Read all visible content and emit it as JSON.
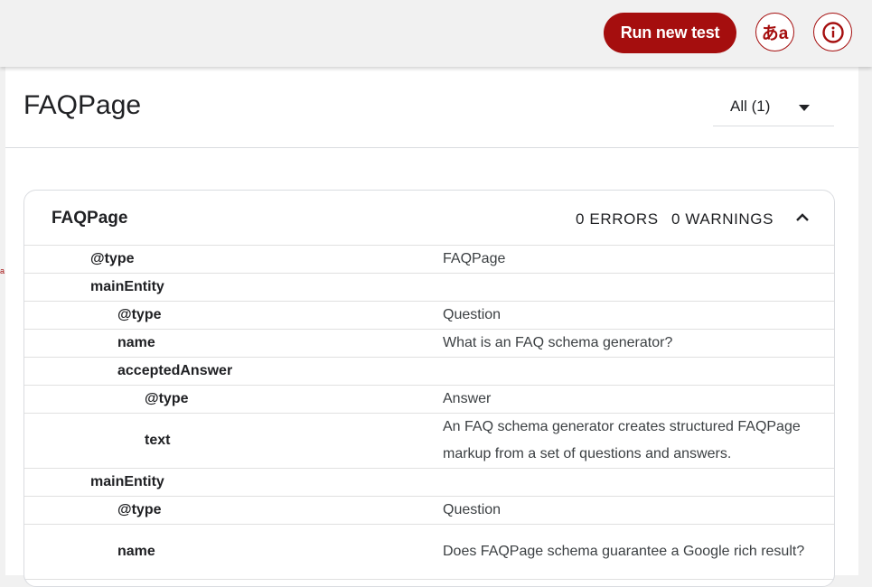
{
  "header": {
    "run_button": "Run new test",
    "language_button": "あa",
    "info_button_icon": "info-icon"
  },
  "panel": {
    "title": "FAQPage",
    "filter_label": "All (1)"
  },
  "card": {
    "title": "FAQPage",
    "errors": "0 ERRORS",
    "warnings": "0 WARNINGS",
    "rows": [
      {
        "key": "@type",
        "value": "FAQPage"
      },
      {
        "key": "mainEntity",
        "value": ""
      },
      {
        "key": "@type",
        "value": "Question"
      },
      {
        "key": "name",
        "value": "What is an FAQ schema generator?"
      },
      {
        "key": "acceptedAnswer",
        "value": ""
      },
      {
        "key": "@type",
        "value": "Answer"
      },
      {
        "key": "text",
        "value": "An FAQ schema generator creates structured FAQPage markup from a set of questions and answers."
      },
      {
        "key": "mainEntity",
        "value": ""
      },
      {
        "key": "@type",
        "value": "Question"
      },
      {
        "key": "name",
        "value": "Does FAQPage schema guarantee a Google rich result?"
      }
    ]
  },
  "colors": {
    "accent": "#a50e0e",
    "background": "#f1f1f1",
    "surface": "#ffffff"
  }
}
